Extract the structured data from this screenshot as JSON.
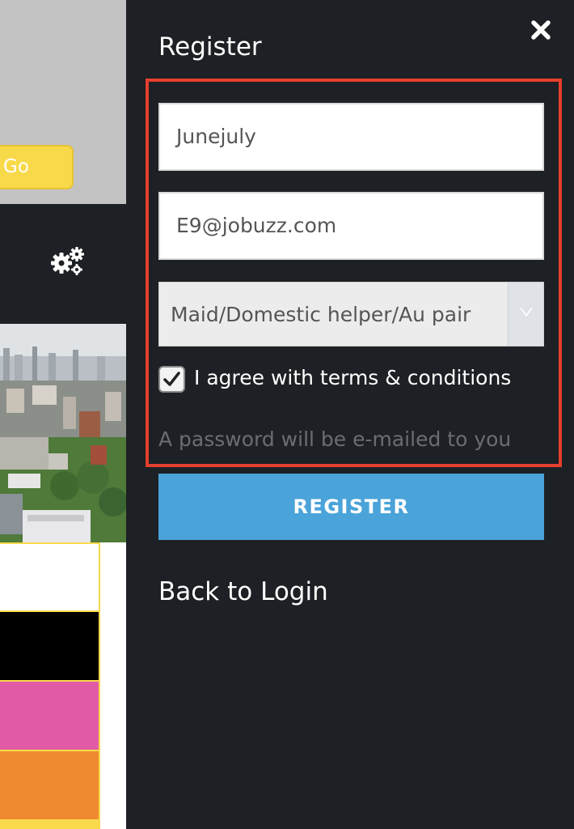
{
  "background_app": {
    "go_button_label": "Go"
  },
  "register_panel": {
    "title": "Register",
    "close_icon": "close-icon",
    "username_value": "Junejuly",
    "email_value": "E9@jobuzz.com",
    "category_selected": "Maid/Domestic helper/Au pair",
    "terms_checked": true,
    "terms_label": "I agree with terms & conditions",
    "password_note": "A password will be e-mailed to you",
    "register_button_label": "REGISTER",
    "back_to_login_label": "Back to Login"
  },
  "colors": {
    "panel_background": "#1d2024",
    "highlight_border": "#e43f2c",
    "register_button": "#4aa3d9",
    "go_button": "#f8d94a"
  }
}
